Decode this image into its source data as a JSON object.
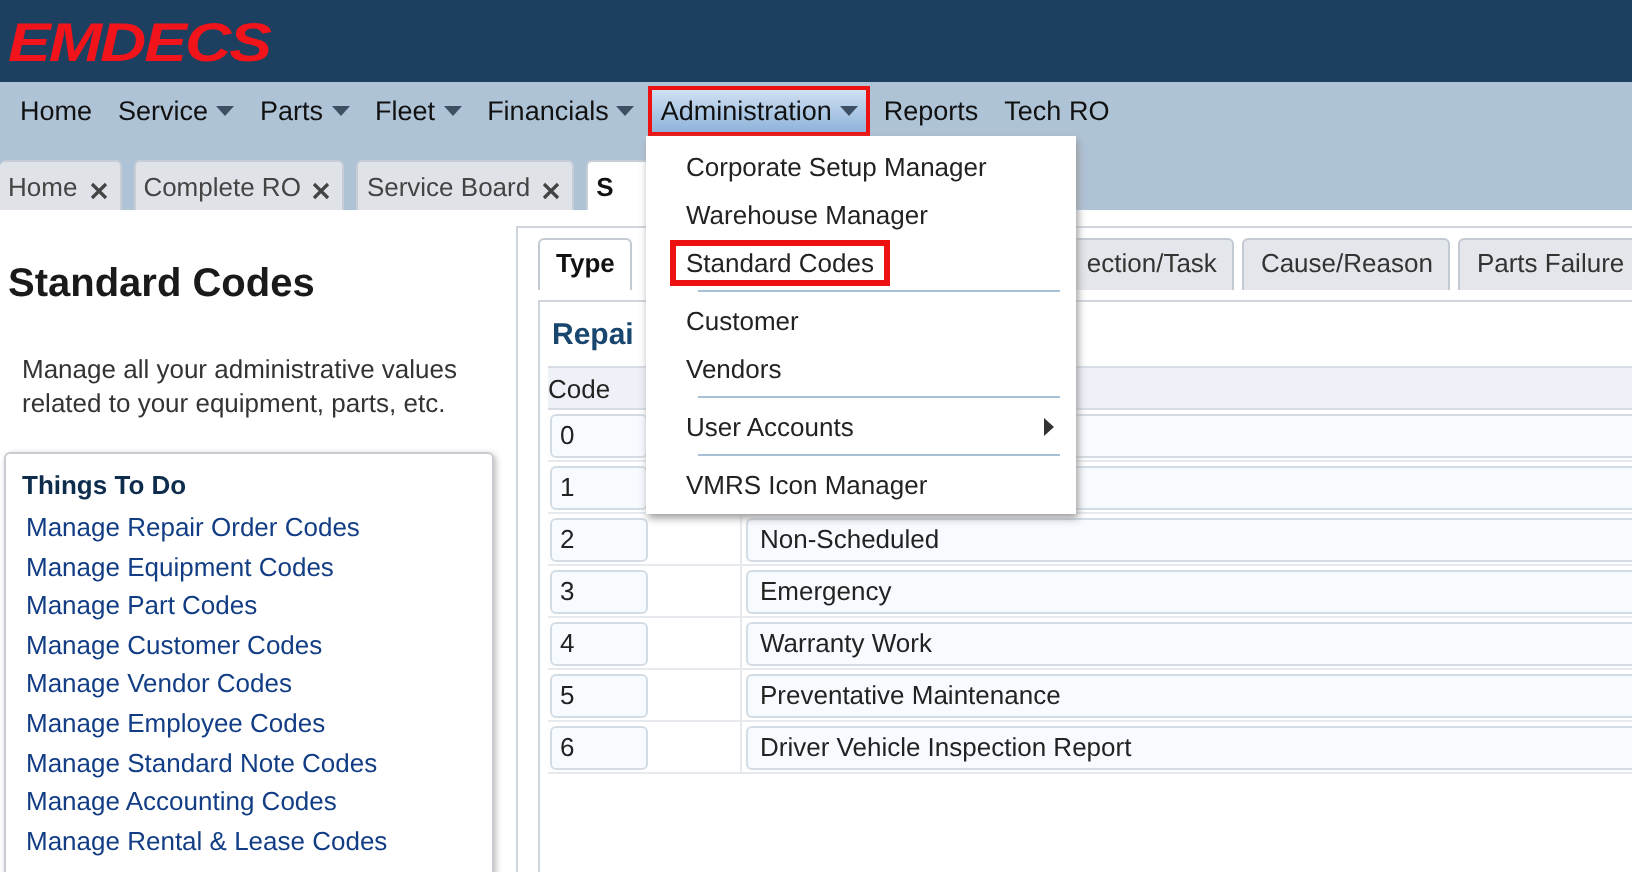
{
  "logo": "EMDECS",
  "nav": [
    {
      "label": "Home",
      "dropdown": false,
      "highlighted": false
    },
    {
      "label": "Service",
      "dropdown": true,
      "highlighted": false
    },
    {
      "label": "Parts",
      "dropdown": true,
      "highlighted": false
    },
    {
      "label": "Fleet",
      "dropdown": true,
      "highlighted": false
    },
    {
      "label": "Financials",
      "dropdown": true,
      "highlighted": false
    },
    {
      "label": "Administration",
      "dropdown": true,
      "highlighted": true
    },
    {
      "label": "Reports",
      "dropdown": false,
      "highlighted": false
    },
    {
      "label": "Tech RO",
      "dropdown": false,
      "highlighted": false
    }
  ],
  "tabs": [
    {
      "label": "Home",
      "closable": true,
      "selected": false
    },
    {
      "label": "Complete RO",
      "closable": true,
      "selected": false
    },
    {
      "label": "Service Board",
      "closable": true,
      "selected": false
    },
    {
      "label": "S",
      "closable": false,
      "selected": true
    }
  ],
  "sidebar": {
    "title": "Standard Codes",
    "description": "Manage all your administrative values related to your equipment, parts, etc.",
    "todo_title": "Things To Do",
    "links": [
      "Manage Repair Order Codes",
      "Manage Equipment Codes",
      "Manage Part Codes",
      "Manage Customer Codes",
      "Manage Vendor Codes",
      "Manage Employee Codes",
      "Manage Standard Note Codes",
      "Manage Accounting Codes",
      "Manage Rental & Lease Codes"
    ]
  },
  "inner_tabs": [
    {
      "label": "Type",
      "selected": true
    },
    {
      "label": "ection/Task",
      "selected": false
    },
    {
      "label": "Cause/Reason",
      "selected": false
    },
    {
      "label": "Parts Failure",
      "selected": false
    }
  ],
  "table": {
    "title": "Repai",
    "columns": [
      "Code"
    ],
    "rows": [
      {
        "code": "0"
      },
      {
        "code": "1"
      },
      {
        "code": "2",
        "description": "Non-Scheduled"
      },
      {
        "code": "3",
        "description": "Emergency"
      },
      {
        "code": "4",
        "description": "Warranty Work"
      },
      {
        "code": "5",
        "description": "Preventative Maintenance"
      },
      {
        "code": "6",
        "description": "Driver Vehicle Inspection Report"
      }
    ]
  },
  "menu": [
    {
      "kind": "item",
      "label": "Corporate Setup Manager",
      "highlighted": false,
      "submenu": false
    },
    {
      "kind": "item",
      "label": "Warehouse Manager",
      "highlighted": false,
      "submenu": false
    },
    {
      "kind": "item",
      "label": "Standard Codes",
      "highlighted": true,
      "submenu": false
    },
    {
      "kind": "separator"
    },
    {
      "kind": "item",
      "label": "Customer",
      "highlighted": false,
      "submenu": false
    },
    {
      "kind": "item",
      "label": "Vendors",
      "highlighted": false,
      "submenu": false
    },
    {
      "kind": "separator"
    },
    {
      "kind": "item",
      "label": "User Accounts",
      "highlighted": false,
      "submenu": true
    },
    {
      "kind": "separator"
    },
    {
      "kind": "item",
      "label": "VMRS Icon Manager",
      "highlighted": false,
      "submenu": false
    }
  ]
}
